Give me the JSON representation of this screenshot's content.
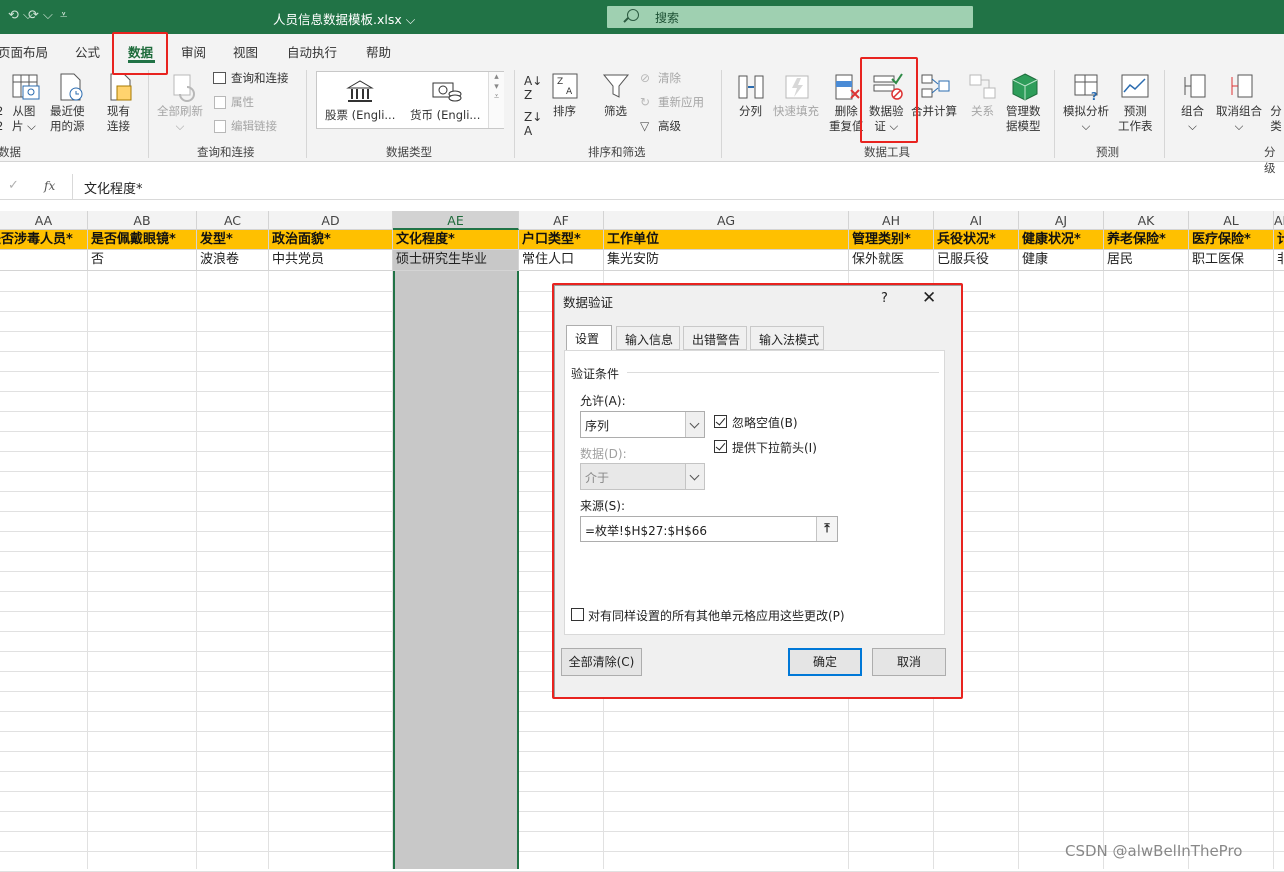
{
  "titlebar": {
    "filename": "人员信息数据模板.xlsx ⌵",
    "search_placeholder": "搜索",
    "undo": "⟲ ⌵",
    "redo": "⟳ ⌵",
    "customize": "⩡"
  },
  "tabs": [
    "页面布局",
    "公式",
    "数据",
    "审阅",
    "视图",
    "自动执行",
    "帮助"
  ],
  "active_tab": "数据",
  "ribbon": {
    "get_data": {
      "from_picture": "从图\n片 ⌵",
      "recent_sources": "最近使\n用的源",
      "existing_conn": "现有\n连接",
      "partial_left_top": "2",
      "partial_left_bottom": "2",
      "group": "获取和转换数据",
      "group_visible": "数据"
    },
    "queries": {
      "refresh_all": "全部刷新\n⌵",
      "queries_connections": "查询和连接",
      "properties": "属性",
      "edit_links": "编辑链接",
      "group": "查询和连接"
    },
    "data_types": {
      "stocks": "股票 (Engli...",
      "currency": "货币 (Engli...",
      "group": "数据类型"
    },
    "sort_filter": {
      "sort": "排序",
      "filter": "筛选",
      "clear": "清除",
      "reapply": "重新应用",
      "advanced": "高级",
      "group": "排序和筛选"
    },
    "data_tools": {
      "text_to_columns": "分列",
      "flash_fill": "快速填充",
      "remove_duplicates": "删除\n重复值",
      "data_validation": "数据验\n证 ⌵",
      "consolidate": "合并计算",
      "relationships": "关系",
      "manage_model": "管理数\n据模型",
      "group": "数据工具"
    },
    "forecast": {
      "what_if": "模拟分析\n⌵",
      "forecast_sheet": "预测\n工作表",
      "group": "预测"
    },
    "outline": {
      "group_btn": "组合\n⌵",
      "ungroup": "取消组合\n⌵",
      "subtotal": "分类",
      "group": "分级显示",
      "group_visible": "分级"
    }
  },
  "formula_bar": {
    "cancel": "✕",
    "confirm": "✓",
    "fx": "fx",
    "value": "文化程度*"
  },
  "columns": [
    {
      "letter": "AA",
      "header": "是否涉毒人员*",
      "value": ""
    },
    {
      "letter": "AB",
      "header": "是否佩戴眼镜*",
      "value": "否"
    },
    {
      "letter": "AC",
      "header": "发型*",
      "value": "波浪卷"
    },
    {
      "letter": "AD",
      "header": "政治面貌*",
      "value": "中共党员"
    },
    {
      "letter": "AE",
      "header": "文化程度*",
      "value": "硕士研究生毕业"
    },
    {
      "letter": "AF",
      "header": "户口类型*",
      "value": "常住人口"
    },
    {
      "letter": "AG",
      "header": "工作单位",
      "value": "集光安防"
    },
    {
      "letter": "AH",
      "header": "管理类别*",
      "value": "保外就医"
    },
    {
      "letter": "AI",
      "header": "兵役状况*",
      "value": "已服兵役"
    },
    {
      "letter": "AJ",
      "header": "健康状况*",
      "value": "健康"
    },
    {
      "letter": "AK",
      "header": "养老保险*",
      "value": "居民"
    },
    {
      "letter": "AL",
      "header": "医疗保险*",
      "value": "职工医保"
    },
    {
      "letter": "AM",
      "header": "计",
      "value": "非"
    }
  ],
  "selected_column": "AE",
  "dialog": {
    "title": "数据验证",
    "help": "?",
    "close": "✕",
    "tabs": [
      "设置",
      "输入信息",
      "出错警告",
      "输入法模式"
    ],
    "section": "验证条件",
    "allow_label": "允许(A):",
    "allow_value": "序列",
    "data_label": "数据(D):",
    "data_value": "介于",
    "ignore_blank": "忽略空值(B)",
    "ignore_blank_checked": true,
    "dropdown": "提供下拉箭头(I)",
    "dropdown_checked": true,
    "source_label": "来源(S):",
    "source_value": "=枚举!$H$27:$H$66",
    "apply_all": "对有同样设置的所有其他单元格应用这些更改(P)",
    "apply_all_checked": false,
    "clear_all": "全部清除(C)",
    "ok": "确定",
    "cancel": "取消"
  },
  "watermark": "CSDN @alwBelInThePro",
  "colors": {
    "title_green": "#217346",
    "header_yellow": "#ffc000",
    "highlight_red": "#e8231f"
  }
}
